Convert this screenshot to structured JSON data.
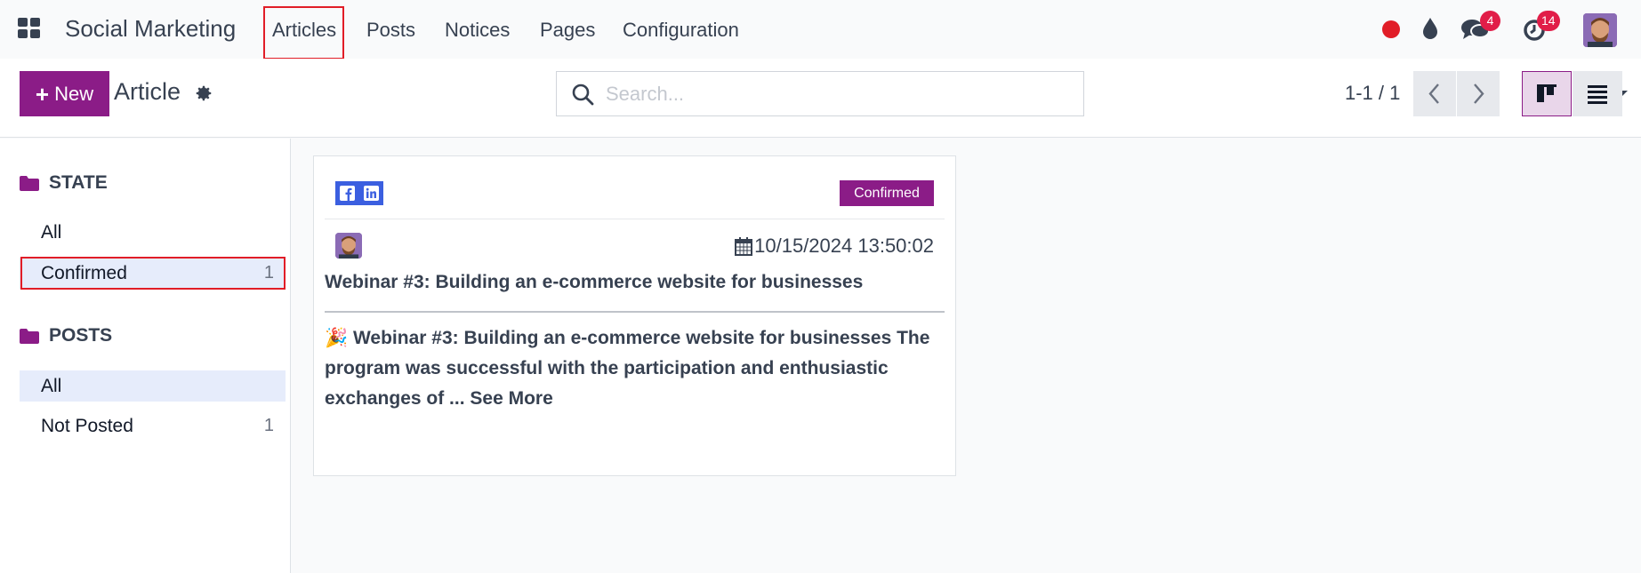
{
  "navbar": {
    "app_name": "Social Marketing",
    "menu": [
      {
        "label": "Articles"
      },
      {
        "label": "Posts"
      },
      {
        "label": "Notices"
      },
      {
        "label": "Pages"
      },
      {
        "label": "Configuration"
      }
    ],
    "messages_count": "4",
    "activities_count": "14"
  },
  "control_panel": {
    "new_label": "New",
    "title": "Article",
    "search_placeholder": "Search...",
    "pager": "1-1 / 1"
  },
  "sidebar": {
    "sections": [
      {
        "title": "STATE",
        "items": [
          {
            "label": "All",
            "count": ""
          },
          {
            "label": "Confirmed",
            "count": "1"
          }
        ]
      },
      {
        "title": "POSTS",
        "items": [
          {
            "label": "All",
            "count": ""
          },
          {
            "label": "Not Posted",
            "count": "1"
          }
        ]
      }
    ]
  },
  "card": {
    "status": "Confirmed",
    "date": "10/15/2024 13:50:02",
    "title": "Webinar #3: Building an e-commerce website for businesses",
    "body": "🎉 Webinar #3: Building an e-commerce website for businesses The program was successful with the participation and enthusiastic exchanges of ... See More"
  },
  "colors": {
    "brand": "#8b1c87",
    "highlight_box": "#e11d27",
    "badge": "#e11d48",
    "status_dot": "#e11d27"
  }
}
